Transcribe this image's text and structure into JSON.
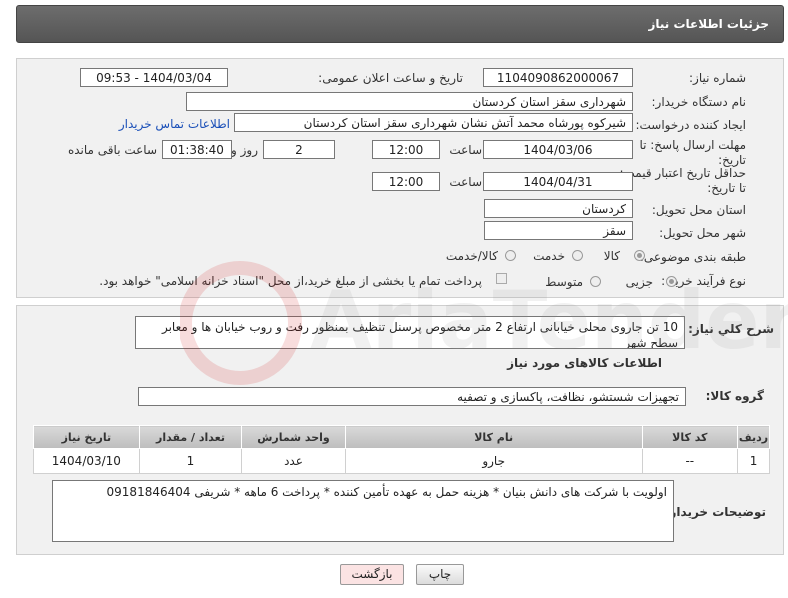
{
  "header": {
    "title": "جزئیات اطلاعات نیاز"
  },
  "form": {
    "need_number_label": "شماره نیاز:",
    "need_number": "1104090862000067",
    "announce_label": "تاریخ و ساعت اعلان عمومی:",
    "announce_value": "1404/03/04 - 09:53",
    "buyer_org_label": "نام دستگاه خریدار:",
    "buyer_org": "شهرداری سقز استان کردستان",
    "requester_label": "ایجاد کننده درخواست:",
    "requester": "شیرکوه پورشاه محمد آتش نشان شهرداری سقز استان کردستان",
    "contact_link": "اطلاعات تماس خریدار",
    "deadline_label_1": "مهلت ارسال پاسخ: تا",
    "deadline_label_2": "تاریخ:",
    "deadline_date": "1404/03/06",
    "time_label": "ساعت",
    "deadline_time": "12:00",
    "days_value": "2",
    "days_label": "روز و",
    "remaining_time": "01:38:40",
    "remaining_label": "ساعت باقی مانده",
    "price_valid_label_1": "حداقل تاریخ اعتبار قیمت:",
    "price_valid_label_2": "تا تاریخ:",
    "price_valid_date": "1404/04/31",
    "price_valid_time": "12:00",
    "province_label": "استان محل تحویل:",
    "province": "کردستان",
    "city_label": "شهر محل تحویل:",
    "city": "سقز",
    "category_label": "طبقه بندی موضوعی:",
    "category_options": [
      "کالا",
      "خدمت",
      "کالا/خدمت"
    ],
    "process_label": "نوع فرآیند خرید :",
    "process_options": [
      "جزیی",
      "متوسط"
    ],
    "payment_note": "پرداخت تمام یا بخشی از مبلغ خرید،از محل \"اسناد خزانه اسلامی\" خواهد بود."
  },
  "description": {
    "label": "شرح كلي نياز:",
    "text": "10 تن جاروی محلی خیابانی ارتفاع 2 متر مخصوص پرسنل تنظیف بمنظور رفت و روب خیابان ها و معابر سطح شهر"
  },
  "goods": {
    "section_title": "اطلاعات کالاهای مورد نیاز",
    "group_label": "گروه کالا:",
    "group_value": "تجهیزات شستشو، نظافت، پاکسازی و تصفیه",
    "columns": [
      "ردیف",
      "کد کالا",
      "نام کالا",
      "واحد شمارش",
      "تعداد / مقدار",
      "تاریخ نیاز"
    ],
    "rows": [
      [
        "1",
        "--",
        "جارو",
        "عدد",
        "1",
        "1404/03/10"
      ]
    ]
  },
  "buyer_notes": {
    "label": "توضیحات خریدار:",
    "text": "اولویت با شرکت های دانش بنیان * هزینه حمل به عهده تأمین کننده * پرداخت 6 ماهه * شریفی 09181846404"
  },
  "buttons": {
    "print": "چاپ",
    "back": "بازگشت"
  },
  "colors": {
    "title_bg": "#606060",
    "panel_bg": "#f1f1f1",
    "link": "#1a4fb8",
    "back_btn": "#fbe3e3"
  }
}
